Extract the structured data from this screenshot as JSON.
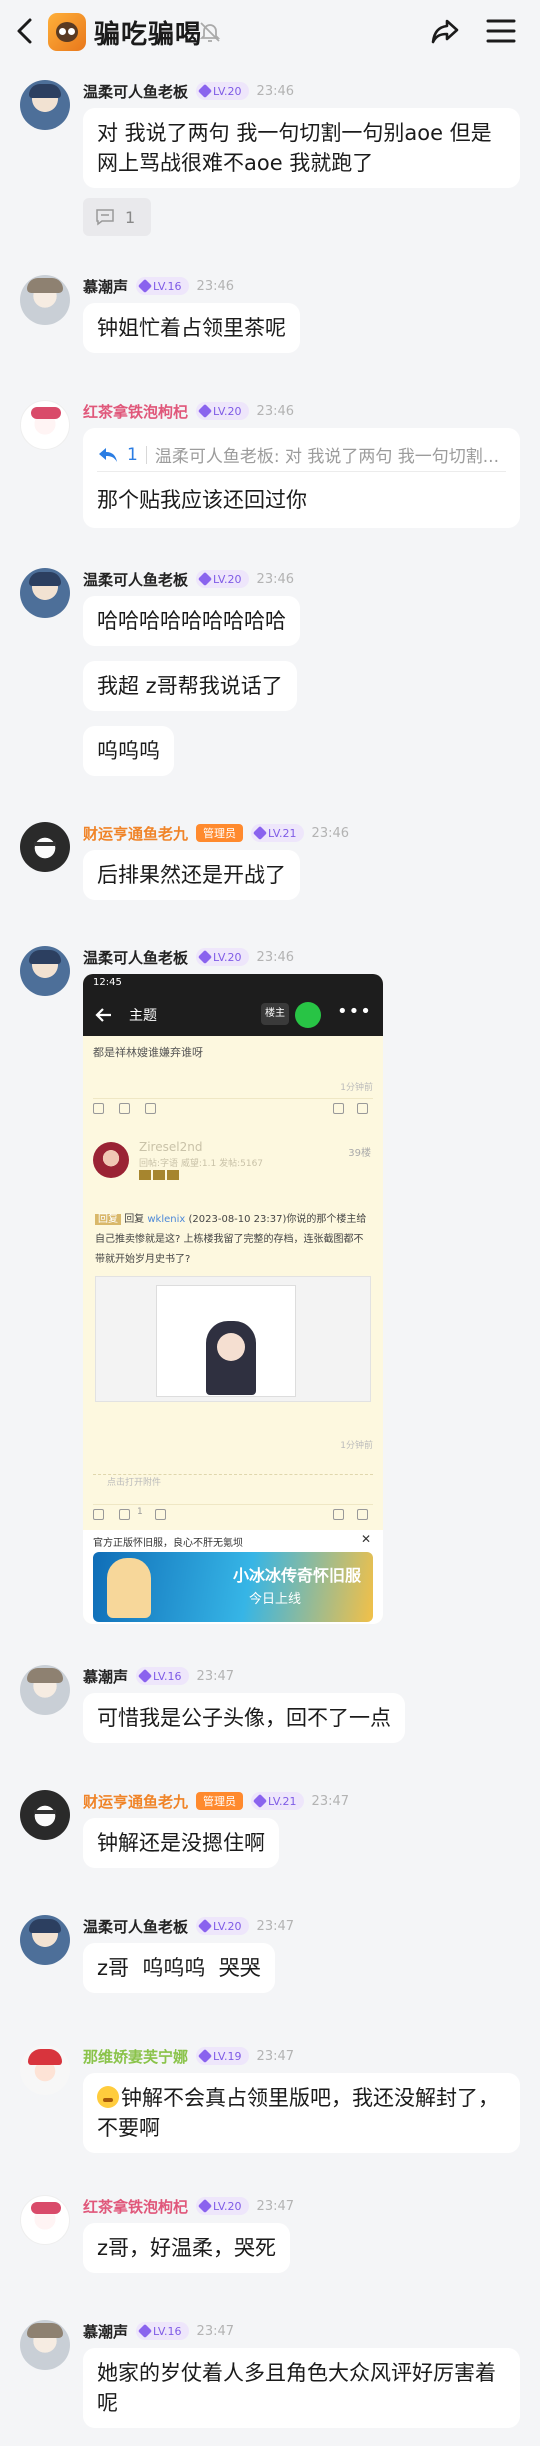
{
  "header": {
    "title": "骗吃骗喝",
    "icons": [
      "back-icon",
      "group-icon",
      "mute-icon",
      "share-icon",
      "menu-icon"
    ]
  },
  "colors": {
    "background": "#f4f5f7",
    "level_badge": "#7f5be6",
    "admin_badge": "#ff8a2e",
    "link": "#2b7de3"
  },
  "messages": [
    {
      "user": "温柔可人鱼老板",
      "level": "LV.20",
      "time": "23:46",
      "text": "对 我说了两句 我一句切割一句别aoe 但是网上骂战很难不aoe 我就跑了",
      "replies": "1"
    },
    {
      "user": "慕潮声",
      "level": "LV.16",
      "time": "23:46",
      "text": "钟姐忙着占领里茶呢"
    },
    {
      "user": "红茶拿铁泡枸杞",
      "level": "LV.20",
      "time": "23:46",
      "quote_count": "1",
      "quote_text": "温柔可人鱼老板: 对 我说了两句 我一句切割...",
      "text": "那个贴我应该还回过你"
    },
    {
      "user": "温柔可人鱼老板",
      "level": "LV.20",
      "time": "23:46",
      "texts": [
        "哈哈哈哈哈哈哈哈哈",
        "我超 z哥帮我说话了",
        "呜呜呜"
      ]
    },
    {
      "user": "财运亨通鱼老九",
      "role": "管理员",
      "level": "LV.21",
      "time": "23:46",
      "text": "后排果然还是开战了"
    },
    {
      "user": "温柔可人鱼老板",
      "level": "LV.20",
      "time": "23:46",
      "screenshot": {
        "status_time": "12:45",
        "header_title": "主题",
        "lz": "楼主",
        "line1": "都是祥林嫂谁嫌弃谁呀",
        "time1": "1分钟前",
        "reply_user": "Ziresel2nd",
        "reply_meta": "回帖:字语 威望:1.1 发帖:5167",
        "floor": "39楼",
        "reply_tag": "回复",
        "reply_prefix": "回复 ",
        "reply_link": "wklenix",
        "reply_text": " (2023-08-10 23:37)你说的那个楼主给自己推卖惨就是这? 上栋楼我留了完整的存档，连张截图都不带就开始岁月史书了?",
        "time2": "1分钟前",
        "attach": "点击打开附件",
        "like_count": "1",
        "ad_title": "官方正版怀旧服，良心不肝无氪坝",
        "ad_close": "✕",
        "ad_banner1": "小冰冰传奇怀旧服",
        "ad_banner2": "今日上线"
      }
    },
    {
      "user": "慕潮声",
      "level": "LV.16",
      "time": "23:47",
      "text": "可惜我是公子头像，回不了一点"
    },
    {
      "user": "财运亨通鱼老九",
      "role": "管理员",
      "level": "LV.21",
      "time": "23:47",
      "text": "钟解还是没摁住啊"
    },
    {
      "user": "温柔可人鱼老板",
      "level": "LV.20",
      "time": "23:47",
      "text": "z哥  呜呜呜  哭哭"
    },
    {
      "user": "那维娇妻芙宁娜",
      "level": "LV.19",
      "time": "23:47",
      "text": "钟解不会真占领里版吧，我还没解封了，不要啊"
    },
    {
      "user": "红茶拿铁泡枸杞",
      "level": "LV.20",
      "time": "23:47",
      "text": "z哥，好温柔，哭死"
    },
    {
      "user": "慕潮声",
      "level": "LV.16",
      "time": "23:47",
      "text": "她家的岁仗着人多且角色大众风评好厉害着呢"
    }
  ]
}
